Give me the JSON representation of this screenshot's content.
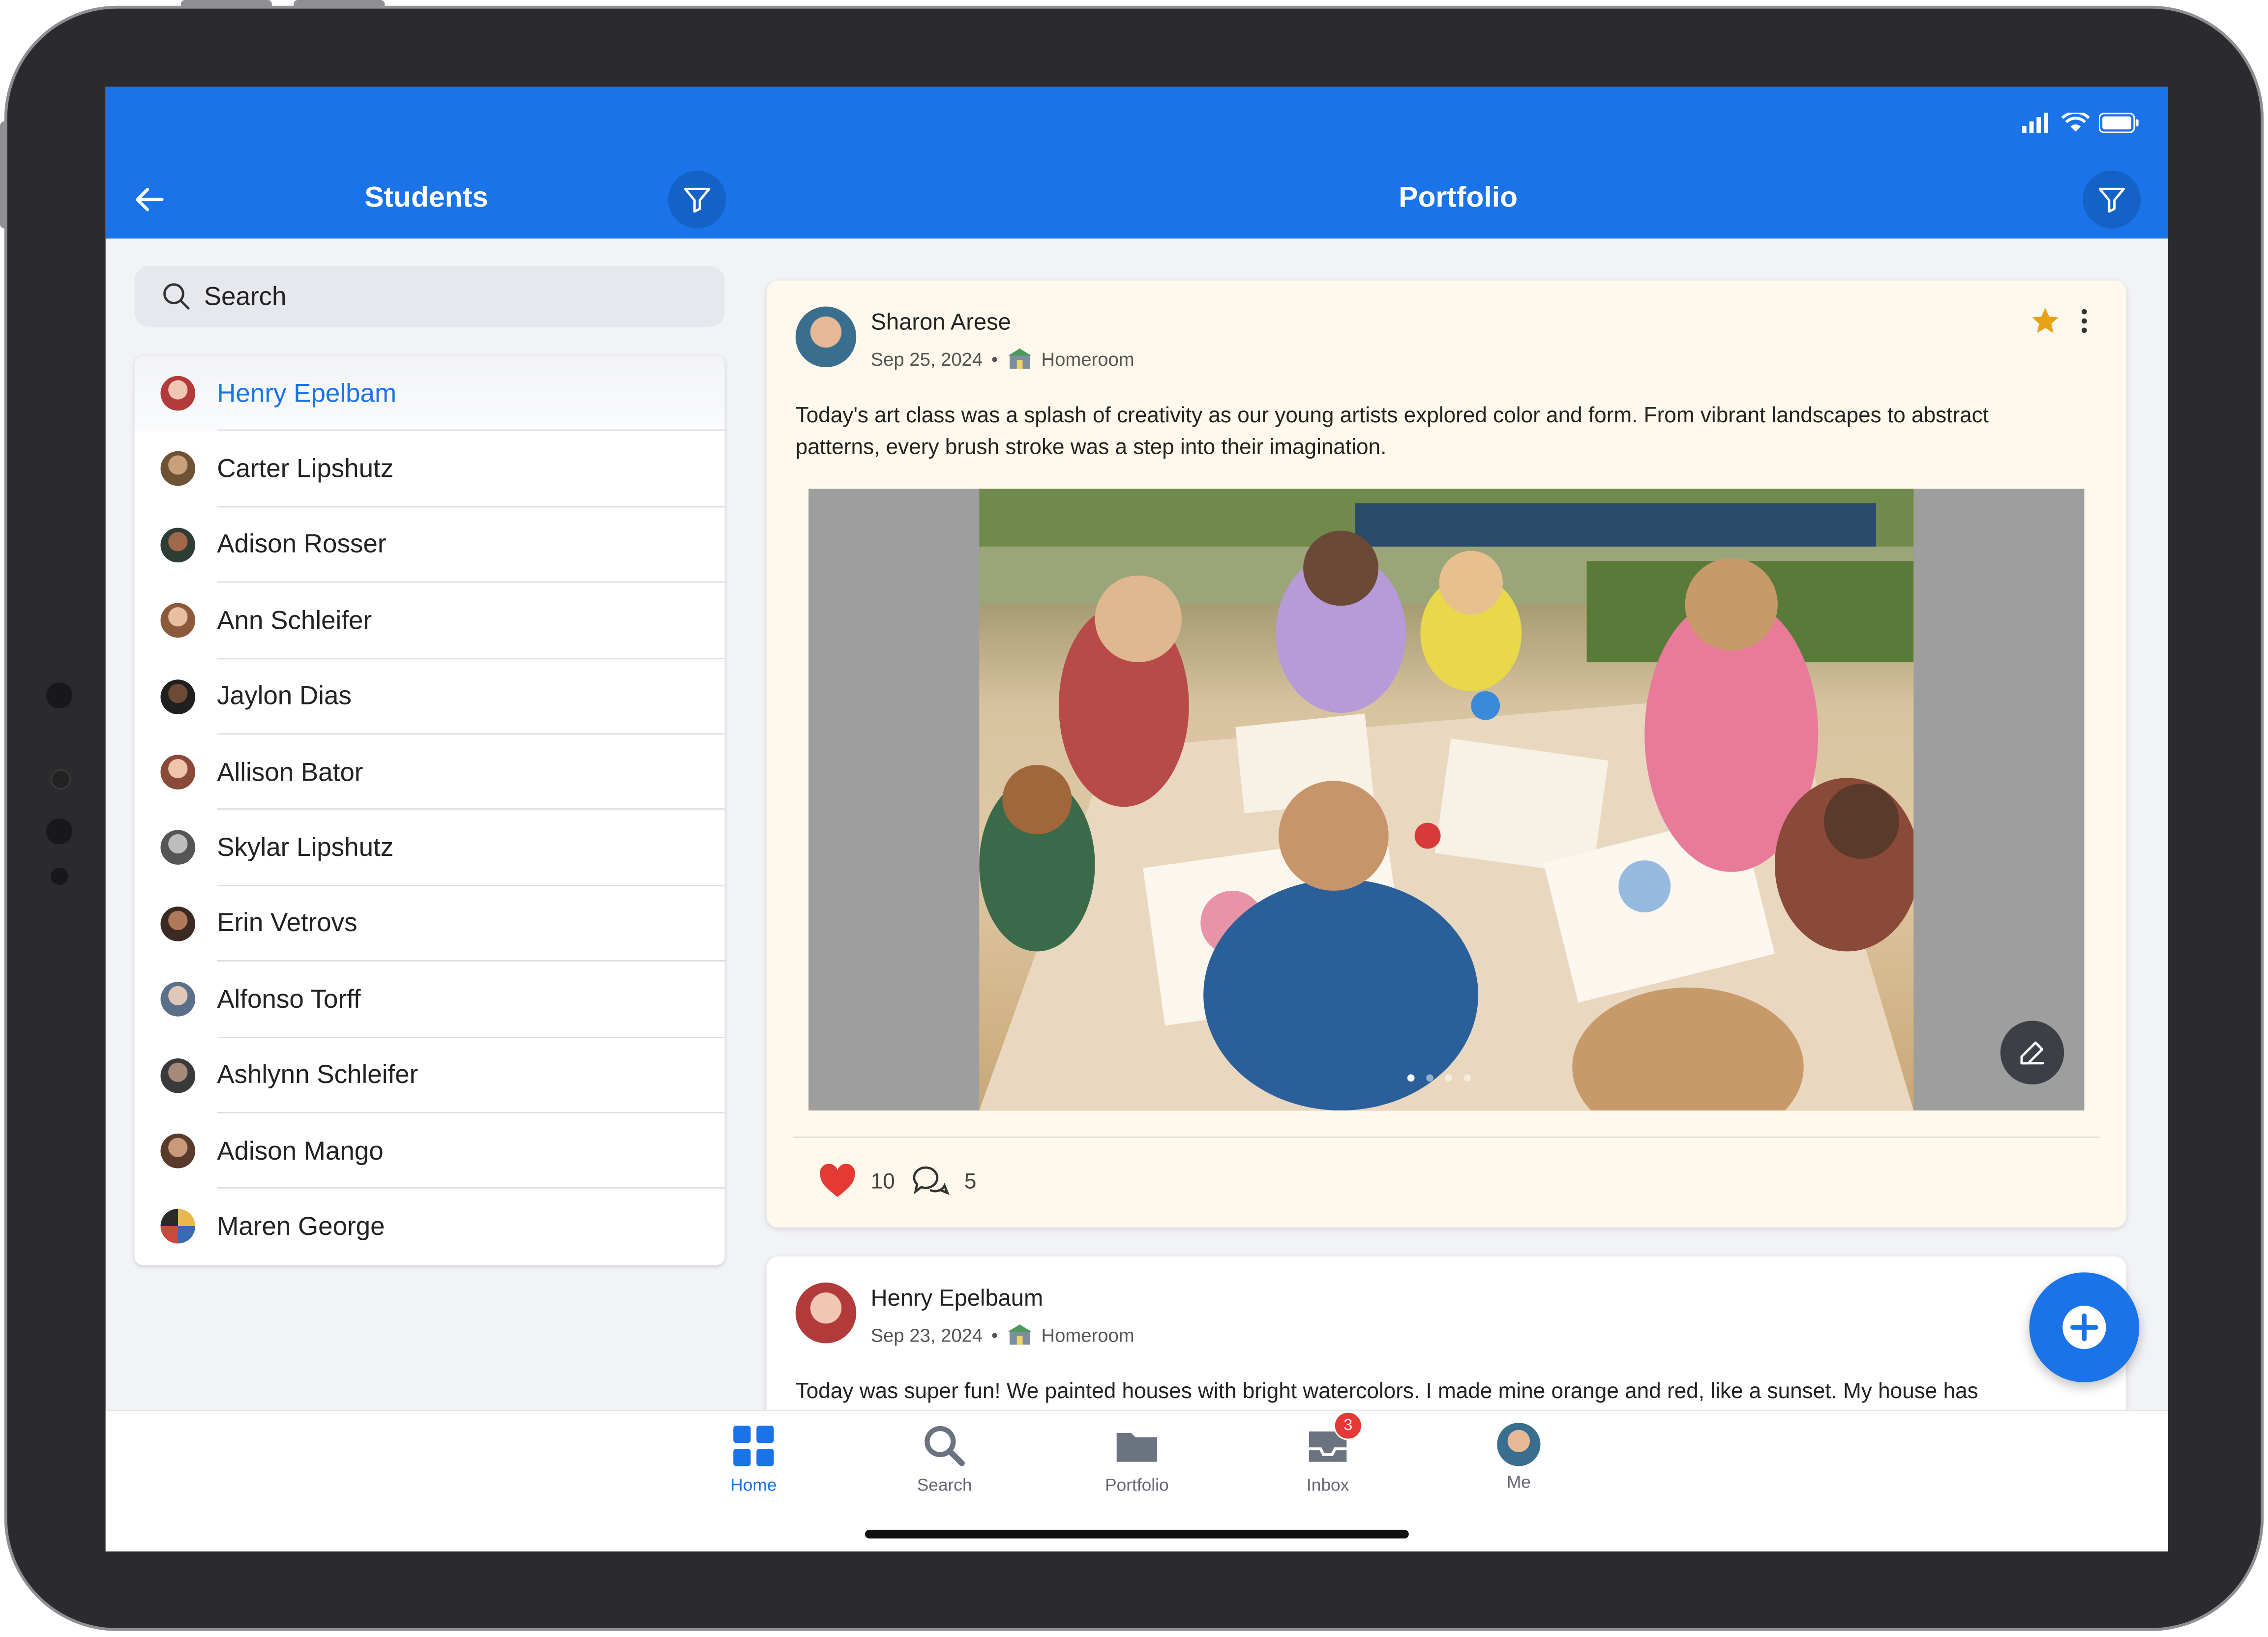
{
  "header": {
    "left_title": "Students",
    "right_title": "Portfolio"
  },
  "search": {
    "placeholder": "Search"
  },
  "students": [
    {
      "name": "Henry Epelbam",
      "selected": true
    },
    {
      "name": "Carter Lipshutz"
    },
    {
      "name": "Adison Rosser"
    },
    {
      "name": "Ann Schleifer"
    },
    {
      "name": "Jaylon Dias"
    },
    {
      "name": "Allison Bator"
    },
    {
      "name": "Skylar Lipshutz"
    },
    {
      "name": "Erin Vetrovs"
    },
    {
      "name": "Alfonso Torff"
    },
    {
      "name": "Ashlynn Schleifer"
    },
    {
      "name": "Adison Mango"
    },
    {
      "name": "Maren George"
    }
  ],
  "posts": [
    {
      "author": "Sharon Arese",
      "date": "Sep 25, 2024",
      "bullet": "•",
      "class_name": "Homeroom",
      "text": "Today's art class was a splash of creativity as our young artists explored color and form. From vibrant landscapes to abstract patterns, every brush stroke was a step into their imagination.",
      "likes": "10",
      "comments": "5"
    },
    {
      "author": "Henry Epelbaum",
      "date": "Sep 23, 2024",
      "bullet": "•",
      "class_name": "Homeroom",
      "text": "Today was super fun! We painted houses with bright watercolors. I made mine orange and red, like a sunset. My house has"
    }
  ],
  "bottom_nav": {
    "home": "Home",
    "search": "Search",
    "portfolio": "Portfolio",
    "inbox": "Inbox",
    "inbox_badge": "3",
    "me": "Me"
  },
  "colors": {
    "primary": "#1a73e8",
    "favorite_star": "#e8a21a",
    "like_heart": "#e53935",
    "badge": "#e53935"
  }
}
